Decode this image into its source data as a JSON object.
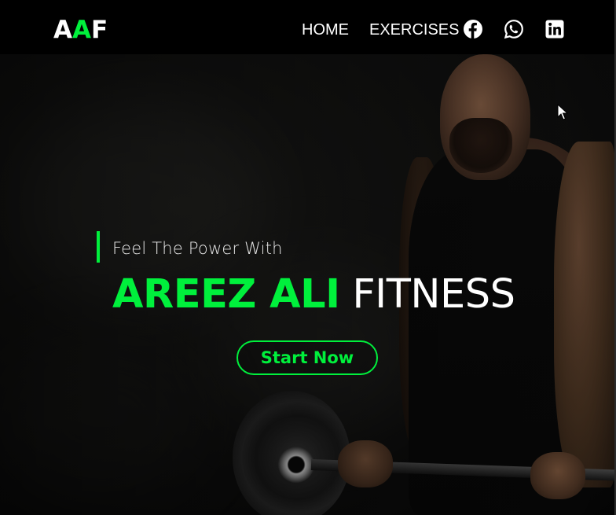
{
  "navbar": {
    "logo": {
      "part1": "A",
      "part2": "A",
      "part3": "F"
    },
    "links": [
      {
        "label": "HOME"
      },
      {
        "label": "EXERCISES"
      }
    ],
    "social": [
      {
        "icon": "facebook-icon"
      },
      {
        "icon": "whatsapp-icon"
      },
      {
        "icon": "linkedin-icon"
      }
    ]
  },
  "hero": {
    "tagline": "Feel The Power With",
    "headline_name": "AREEZ ALI",
    "headline_word": "FITNESS",
    "cta_label": "Start Now"
  },
  "colors": {
    "accent": "#00f03c",
    "navbar_bg": "#000000",
    "text": "#ffffff"
  }
}
